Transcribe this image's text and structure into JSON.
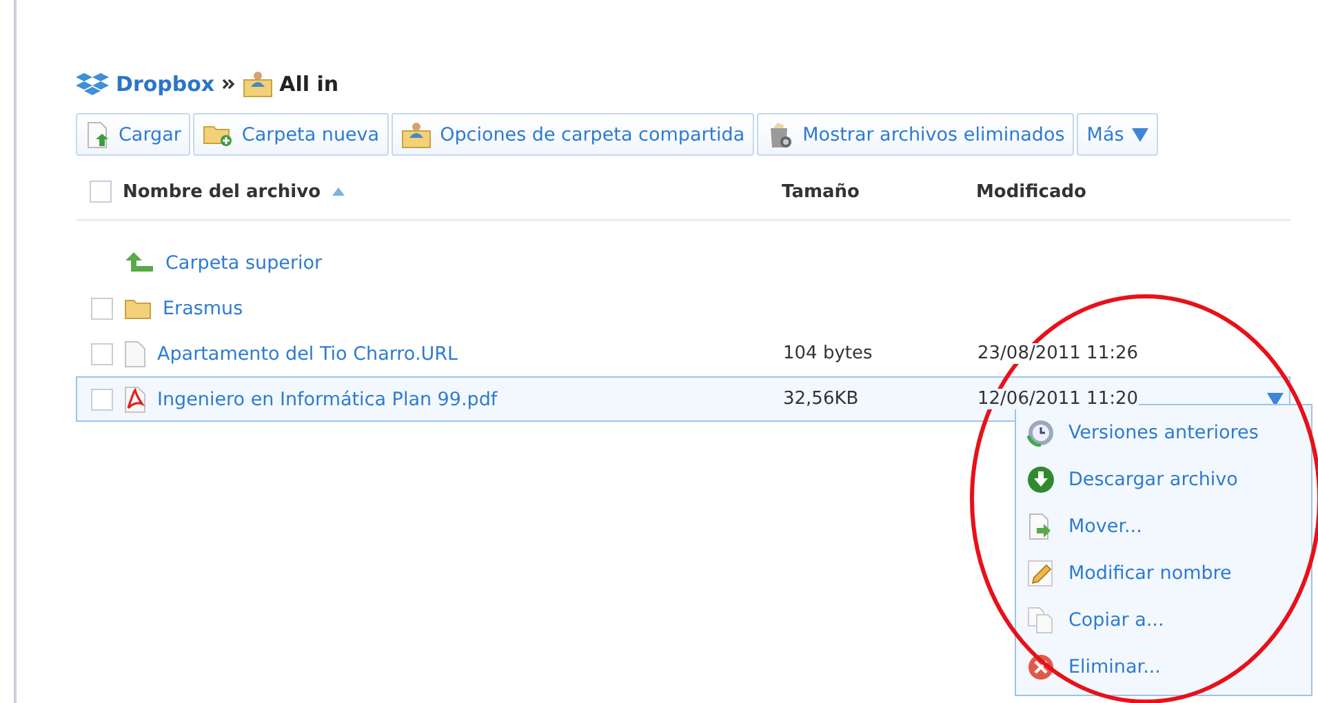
{
  "breadcrumb": [
    {
      "label": "Dropbox",
      "kind": "root"
    },
    {
      "label": "All in",
      "kind": "shared"
    }
  ],
  "toolbar": [
    {
      "label": "Cargar",
      "kind": "upload"
    },
    {
      "label": "Carpeta nueva",
      "kind": "newfolder"
    },
    {
      "label": "Opciones de carpeta compartida",
      "kind": "shared"
    },
    {
      "label": "Mostrar archivos eliminados",
      "kind": "trash"
    },
    {
      "label": "Más",
      "kind": "more"
    }
  ],
  "table": {
    "select_all": {
      "checked": false
    },
    "columns": [
      "Nombre del archivo",
      "Tamaño",
      "Modificado"
    ],
    "rows": [
      {
        "kind": "parent",
        "name": "Carpeta superior",
        "selected": false
      },
      {
        "kind": "folder",
        "name": "Erasmus",
        "checked": false,
        "selected": false
      },
      {
        "kind": "file",
        "name": "Apartamento del Tio Charro.URL",
        "size": "104 bytes",
        "modified": "23/08/2011 11:26",
        "checked": false,
        "selected": false
      },
      {
        "kind": "pdf",
        "name": "Ingeniero en Informática Plan 99.pdf",
        "size": "32,56KB",
        "modified": "12/06/2011 11:20",
        "checked": false,
        "selected": true
      }
    ]
  },
  "context_menu": [
    {
      "label": "Versiones anteriores",
      "kind": "versions"
    },
    {
      "label": "Descargar archivo",
      "kind": "download"
    },
    {
      "label": "Mover...",
      "kind": "move"
    },
    {
      "label": "Modificar nombre",
      "kind": "rename"
    },
    {
      "label": "Copiar a...",
      "kind": "copy"
    },
    {
      "label": "Eliminar...",
      "kind": "delete"
    }
  ]
}
